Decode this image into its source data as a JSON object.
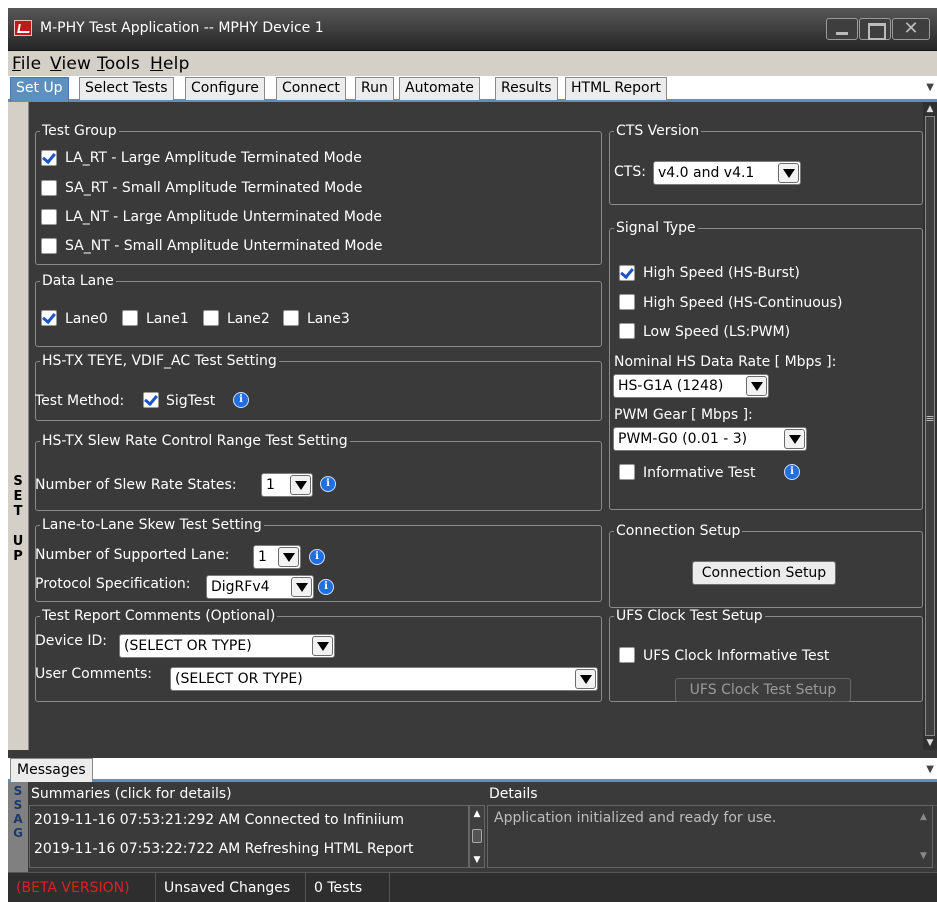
{
  "window": {
    "title": "M-PHY Test Application -- MPHY Device 1"
  },
  "menu": {
    "file": "File",
    "view": "View",
    "tools": "Tools",
    "help": "Help"
  },
  "tabs": [
    "Set Up",
    "Select Tests",
    "Configure",
    "Connect",
    "Run",
    "Automate",
    "Results",
    "HTML Report"
  ],
  "side_tab": "S E T U P",
  "test_group": {
    "legend": "Test Group",
    "items": [
      {
        "label": "LA_RT - Large Amplitude Terminated Mode",
        "checked": true
      },
      {
        "label": "SA_RT - Small Amplitude Terminated Mode",
        "checked": false
      },
      {
        "label": "LA_NT - Large Amplitude Unterminated Mode",
        "checked": false
      },
      {
        "label": "SA_NT - Small Amplitude Unterminated Mode",
        "checked": false
      }
    ]
  },
  "data_lane": {
    "legend": "Data Lane",
    "lanes": [
      {
        "label": "Lane0",
        "checked": true
      },
      {
        "label": "Lane1",
        "checked": false
      },
      {
        "label": "Lane2",
        "checked": false
      },
      {
        "label": "Lane3",
        "checked": false
      }
    ]
  },
  "teye": {
    "legend": "HS-TX TEYE, VDIF_AC Test Setting",
    "method_label": "Test Method:",
    "sigtest_label": "SigTest",
    "sigtest_checked": true
  },
  "slew": {
    "legend": "HS-TX Slew Rate Control Range Test Setting",
    "states_label": "Number of Slew Rate States:",
    "states_value": "1"
  },
  "skew": {
    "legend": "Lane-to-Lane Skew Test Setting",
    "lanes_label": "Number of Supported Lane:",
    "lanes_value": "1",
    "protocol_label": "Protocol Specification:",
    "protocol_value": "DigRFv4"
  },
  "comments": {
    "legend": "Test Report Comments (Optional)",
    "device_label": "Device ID:",
    "device_value": "(SELECT OR TYPE)",
    "user_label": "User Comments:",
    "user_value": "(SELECT OR TYPE)"
  },
  "cts": {
    "legend": "CTS Version",
    "label": "CTS:",
    "value": "v4.0 and v4.1"
  },
  "signal_type": {
    "legend": "Signal Type",
    "items": [
      {
        "label": "High Speed (HS-Burst)",
        "checked": true
      },
      {
        "label": "High Speed (HS-Continuous)",
        "checked": false
      },
      {
        "label": "Low Speed (LS:PWM)",
        "checked": false
      }
    ],
    "hs_rate_label": "Nominal HS Data Rate [ Mbps ]:",
    "hs_rate_value": "HS-G1A (1248)",
    "pwm_label": "PWM Gear [ Mbps ]:",
    "pwm_value": "PWM-G0 (0.01 - 3)",
    "informative_label": "Informative Test",
    "informative_checked": false
  },
  "connection": {
    "legend": "Connection Setup",
    "button": "Connection Setup"
  },
  "ufs": {
    "legend": "UFS Clock Test Setup",
    "checkbox_label": "UFS Clock Informative Test",
    "checked": false,
    "button": "UFS Clock Test Setup"
  },
  "messages": {
    "tab": "Messages",
    "side": "M E S S A G E S",
    "summaries_header": "Summaries (click for details)",
    "details_header": "Details",
    "summaries": [
      "2019-11-16 07:53:21:292 AM Connected to Infiniium",
      "2019-11-16 07:53:22:722 AM Refreshing HTML Report"
    ],
    "details": "Application initialized and ready for use."
  },
  "status": {
    "beta": "(BETA VERSION)",
    "changes": "Unsaved Changes",
    "tests": "0 Tests"
  },
  "colors": {
    "panel_bg": "#3a3a3a",
    "active_tab": "#5d8fc0",
    "beta_red": "#e02020",
    "check_blue": "#1a55c8"
  }
}
